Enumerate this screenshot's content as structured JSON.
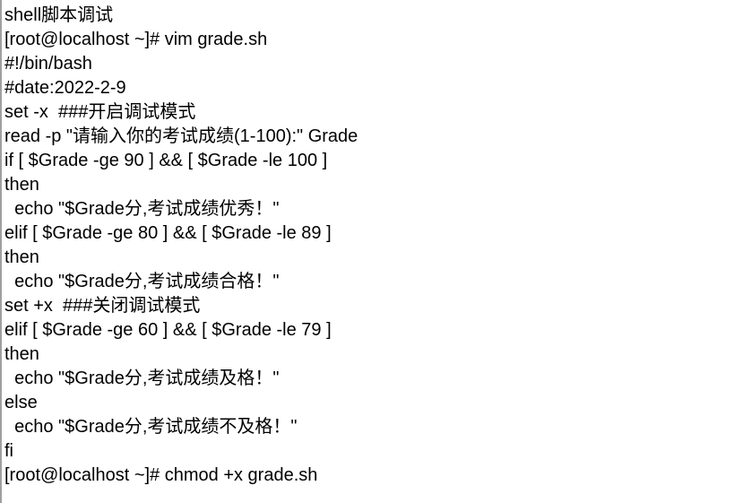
{
  "document": {
    "lines": [
      "shell脚本调试",
      "[root@localhost ~]# vim grade.sh",
      "#!/bin/bash",
      "#date:2022-2-9",
      "set -x  ###开启调试模式",
      "read -p \"请输入你的考试成绩(1-100):\" Grade",
      "if [ $Grade -ge 90 ] && [ $Grade -le 100 ]",
      "then",
      "  echo \"$Grade分,考试成绩优秀！\"",
      "elif [ $Grade -ge 80 ] && [ $Grade -le 89 ]",
      "then",
      "  echo \"$Grade分,考试成绩合格！\"",
      "set +x  ###关闭调试模式",
      "elif [ $Grade -ge 60 ] && [ $Grade -le 79 ]",
      "then",
      "  echo \"$Grade分,考试成绩及格！\"",
      "else",
      "  echo \"$Grade分,考试成绩不及格！\"",
      "fi",
      "[root@localhost ~]# chmod +x grade.sh"
    ]
  }
}
